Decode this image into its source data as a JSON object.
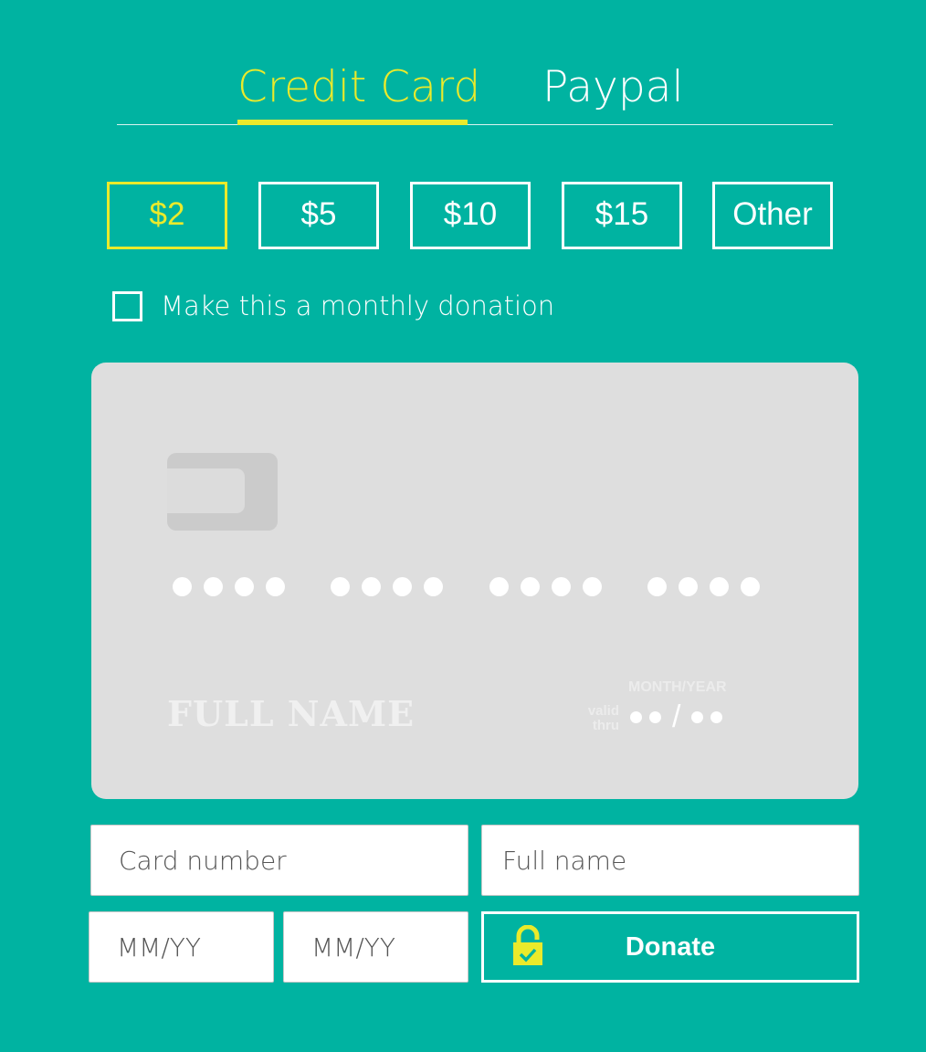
{
  "tabs": [
    {
      "label": "Credit Card",
      "active": true
    },
    {
      "label": "Paypal",
      "active": false
    }
  ],
  "amounts": [
    {
      "label": "$2",
      "selected": true
    },
    {
      "label": "$5",
      "selected": false
    },
    {
      "label": "$10",
      "selected": false
    },
    {
      "label": "$15",
      "selected": false
    },
    {
      "label": "Other",
      "selected": false
    }
  ],
  "monthly": {
    "label": "Make this a monthly donation",
    "checked": false
  },
  "card_preview": {
    "name": "FULL NAME",
    "valid_label_1": "valid",
    "valid_label_2": "thru",
    "expiry_label": "MONTH/YEAR"
  },
  "form": {
    "card_number_placeholder": "Card number",
    "full_name_placeholder": "Full name",
    "expiry_month_placeholder": "MM/YY",
    "expiry_year_placeholder": "MM/YY",
    "donate_label": "Donate"
  },
  "colors": {
    "background": "#00b3a1",
    "accent": "#eaea2b",
    "card": "#dedede"
  },
  "icons": {
    "lock": "lock-icon"
  }
}
